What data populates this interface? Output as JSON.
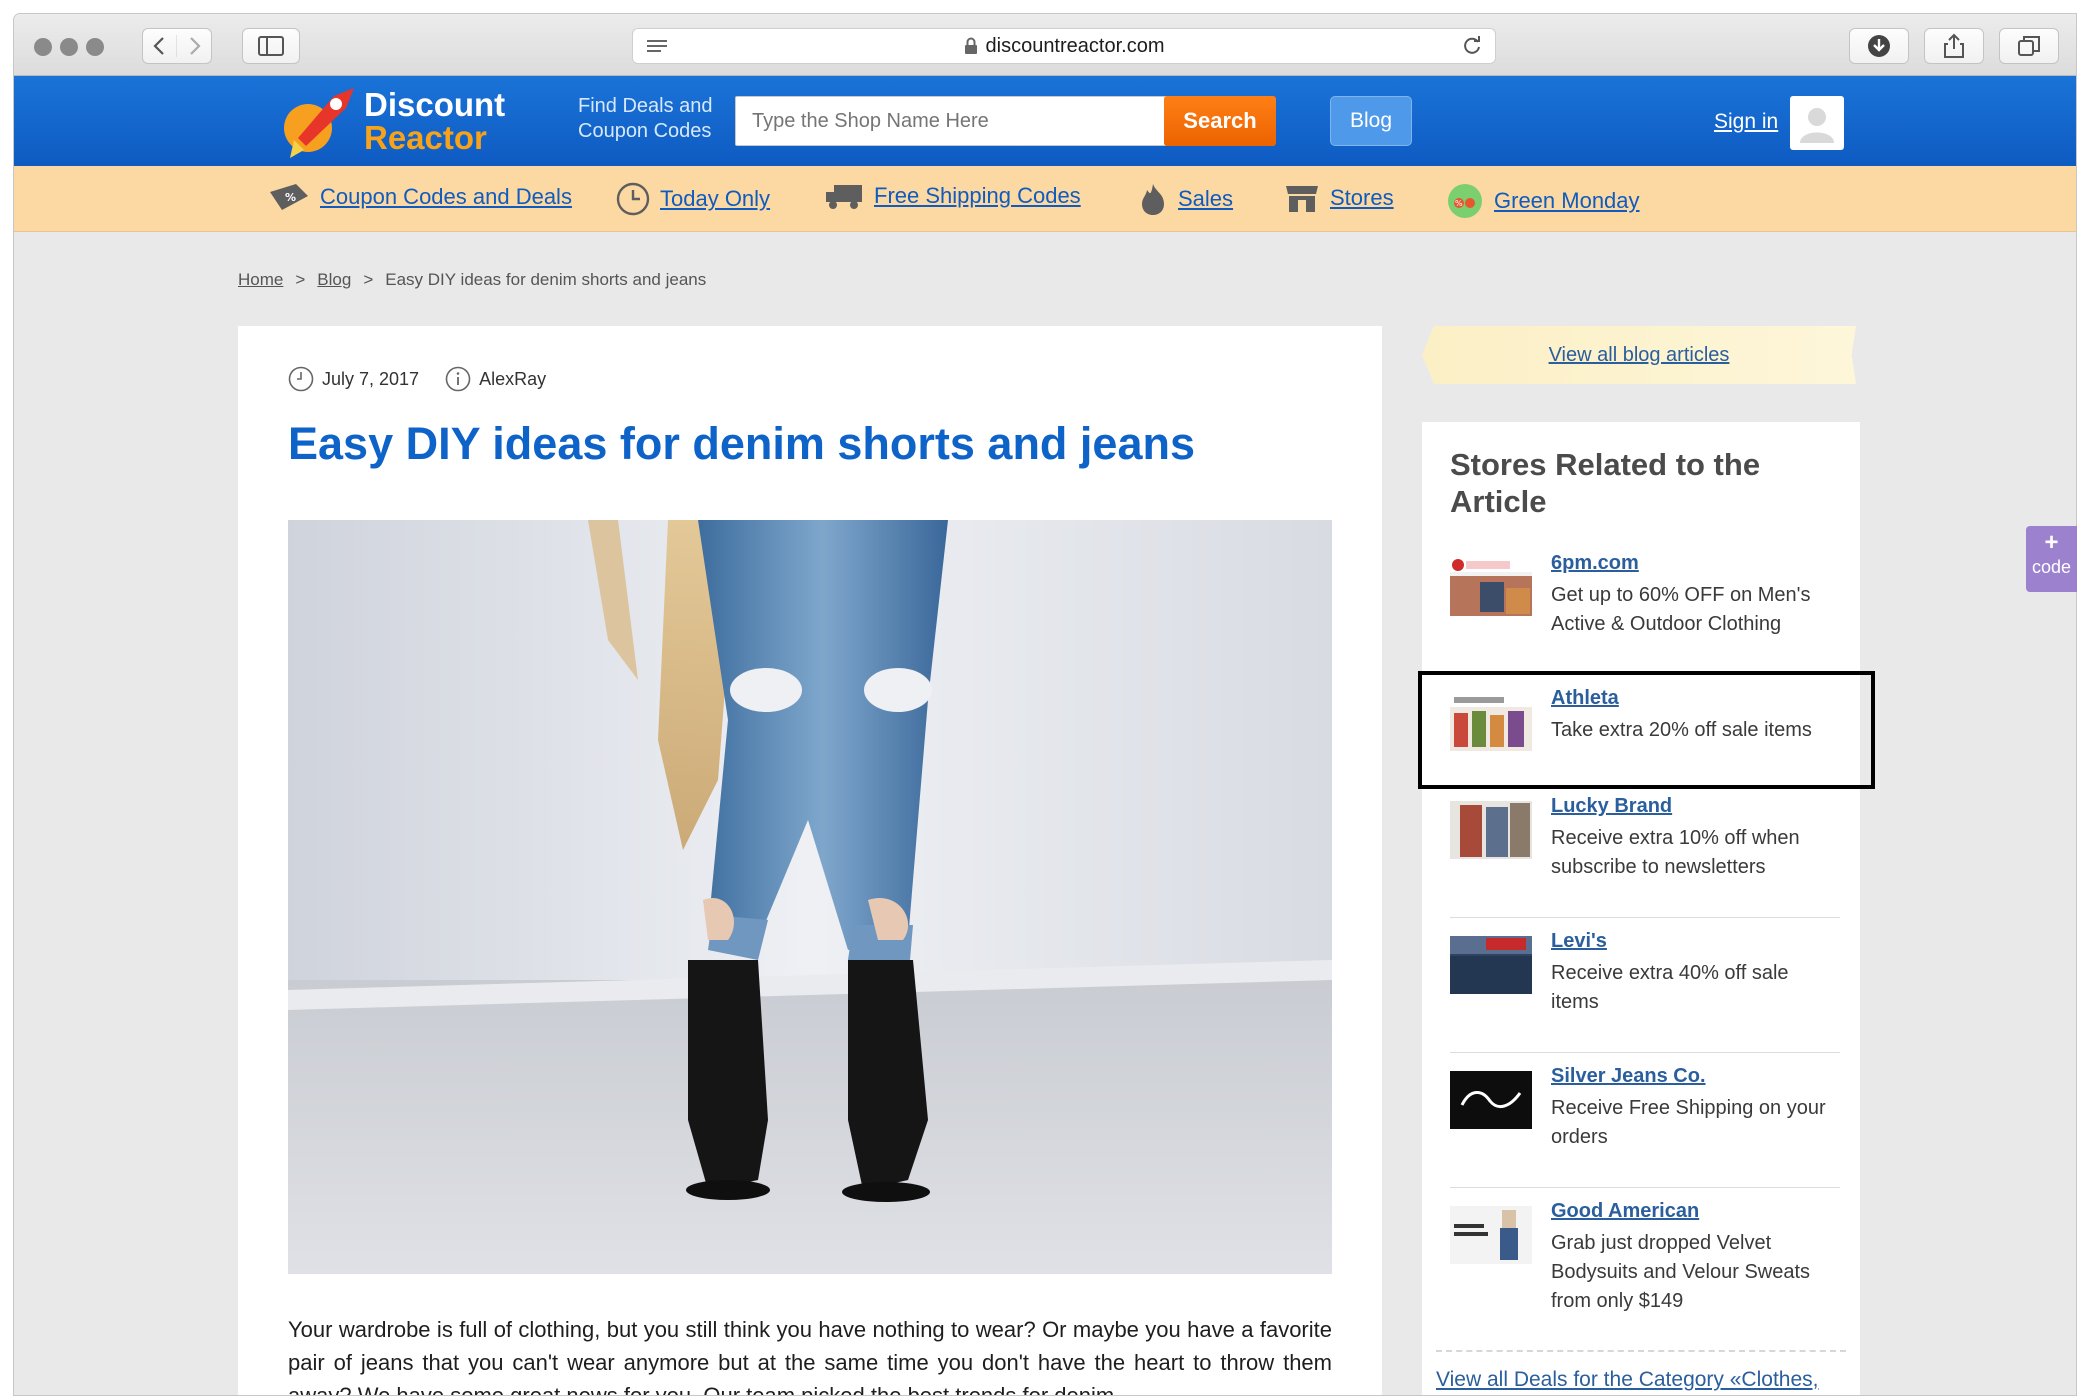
{
  "browser": {
    "url": "discountreactor.com"
  },
  "header": {
    "logo_line1": "Discount",
    "logo_line2": "Reactor",
    "find_deals": "Find Deals and Coupon Codes",
    "search_placeholder": "Type the Shop Name Here",
    "search_label": "Search",
    "blog_label": "Blog",
    "signin_label": "Sign in"
  },
  "nav": {
    "items": [
      {
        "label": "Coupon Codes and Deals",
        "icon": "coupon-tag-icon"
      },
      {
        "label": "Today Only",
        "icon": "clock-icon"
      },
      {
        "label": "Free Shipping Codes",
        "icon": "truck-icon"
      },
      {
        "label": "Sales",
        "icon": "fire-icon"
      },
      {
        "label": "Stores",
        "icon": "store-icon"
      },
      {
        "label": "Green Monday",
        "icon": "green-monday-icon"
      }
    ]
  },
  "breadcrumb": {
    "home": "Home",
    "blog": "Blog",
    "current": "Easy DIY ideas for denim shorts and jeans",
    "sep": ">"
  },
  "article": {
    "date": "July 7, 2017",
    "author": "AlexRay",
    "title": "Easy DIY ideas for denim shorts and jeans",
    "body": "Your wardrobe is full of clothing, but you still think you have nothing to wear? Or maybe you have a favorite pair of jeans that you can't wear anymore but at the same time you don't have the heart to throw them away? We have some great news for you. Our team picked the best trends for denim"
  },
  "sidebar": {
    "view_all_blog": "View all blog articles",
    "title": "Stores Related to the Article",
    "stores": [
      {
        "name": "6pm.com",
        "desc": "Get up to 60% OFF on Men's Active & Outdoor Clothing"
      },
      {
        "name": "Athleta",
        "desc": "Take extra 20% off sale items"
      },
      {
        "name": "Lucky Brand",
        "desc": "Receive extra 10% off when subscribe to newsletters"
      },
      {
        "name": "Levi's",
        "desc": "Receive extra 40% off sale items"
      },
      {
        "name": "Silver Jeans Co.",
        "desc": "Receive Free Shipping on your orders"
      },
      {
        "name": "Good American",
        "desc": "Grab just dropped Velvet Bodysuits and Velour Sweats from only $149"
      }
    ],
    "footer_link": "View all Deals for the Category «Clothes,"
  },
  "side_tab": {
    "plus": "+",
    "label": "code"
  },
  "colors": {
    "header_blue": "#1469d2",
    "nav_orange": "#fcd9a2",
    "search_orange": "#f57010",
    "title_blue": "#0e63c9",
    "link_blue": "#2a5e9c"
  }
}
